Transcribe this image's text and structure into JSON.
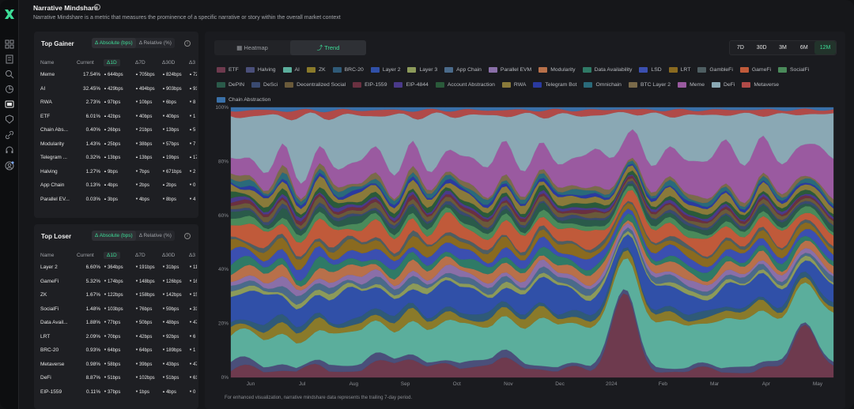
{
  "header": {
    "title": "Narrative Mindshare",
    "subtitle": "Narrative Mindshare is a metric that measures the prominence of a specific narrative or story within the overall market context"
  },
  "gainer": {
    "title": "Top Gainer",
    "toggle": [
      "Δ Absolute (bps)",
      "Δ Relative (%)"
    ],
    "columns": [
      "Name",
      "Current",
      "Δ1D",
      "Δ7D",
      "Δ30D",
      "Δ3"
    ],
    "rows": [
      {
        "name": "Meme",
        "current": "17.54%",
        "d1": "644bps",
        "d7": "705bps",
        "d30": "824bps",
        "d3": "72",
        "d1u": true,
        "d7u": true,
        "d30u": true,
        "d3u": true
      },
      {
        "name": "AI",
        "current": "32.45%",
        "d1": "429bps",
        "d7": "494bps",
        "d30": "903bps",
        "d3": "91",
        "d1u": true,
        "d7u": true,
        "d30u": true,
        "d3u": true
      },
      {
        "name": "RWA",
        "current": "2.73%",
        "d1": "97bps",
        "d7": "10bps",
        "d30": "6bps",
        "d3": "8",
        "d1u": true,
        "d7u": false,
        "d30u": false,
        "d3u": false
      },
      {
        "name": "ETF",
        "current": "6.01%",
        "d1": "42bps",
        "d7": "40bps",
        "d30": "40bps",
        "d3": "1",
        "d1u": true,
        "d7u": false,
        "d30u": false,
        "d3u": false
      },
      {
        "name": "Chain Abs...",
        "current": "0.40%",
        "d1": "26bps",
        "d7": "21bps",
        "d30": "13bps",
        "d3": "5",
        "d1u": true,
        "d7u": false,
        "d30u": false,
        "d3u": true
      },
      {
        "name": "Modularity",
        "current": "1.43%",
        "d1": "25bps",
        "d7": "38bps",
        "d30": "57bps",
        "d3": "7",
        "d1u": true,
        "d7u": false,
        "d30u": false,
        "d3u": false
      },
      {
        "name": "Telegram ...",
        "current": "0.32%",
        "d1": "13bps",
        "d7": "13bps",
        "d30": "19bps",
        "d3": "17",
        "d1u": true,
        "d7u": true,
        "d30u": true,
        "d3u": true
      },
      {
        "name": "Halving",
        "current": "1.27%",
        "d1": "9bps",
        "d7": "7bps",
        "d30": "671bps",
        "d3": "2",
        "d1u": true,
        "d7u": false,
        "d30u": false,
        "d3u": false
      },
      {
        "name": "App Chain",
        "current": "0.13%",
        "d1": "4bps",
        "d7": "2bps",
        "d30": "2bps",
        "d3": "0",
        "d1u": true,
        "d7u": false,
        "d30u": true,
        "d3u": false
      },
      {
        "name": "Parallel EV...",
        "current": "0.03%",
        "d1": "3bps",
        "d7": "4bps",
        "d30": "8bps",
        "d3": "4",
        "d1u": true,
        "d7u": false,
        "d30u": false,
        "d3u": false
      }
    ]
  },
  "loser": {
    "title": "Top Loser",
    "toggle": [
      "Δ Absolute (bps)",
      "Δ Relative (%)"
    ],
    "columns": [
      "Name",
      "Current",
      "Δ1D",
      "Δ7D",
      "Δ30D",
      "Δ3"
    ],
    "rows": [
      {
        "name": "Layer 2",
        "current": "6.60%",
        "d1": "364bps",
        "d7": "191bps",
        "d30": "31bps",
        "d3": "11",
        "d1u": false,
        "d7u": false,
        "d30u": false,
        "d3u": false
      },
      {
        "name": "GameFi",
        "current": "5.32%",
        "d1": "174bps",
        "d7": "148bps",
        "d30": "126bps",
        "d3": "16",
        "d1u": false,
        "d7u": false,
        "d30u": false,
        "d3u": false
      },
      {
        "name": "ZK",
        "current": "1.67%",
        "d1": "122bps",
        "d7": "158bps",
        "d30": "142bps",
        "d3": "15",
        "d1u": false,
        "d7u": false,
        "d30u": false,
        "d3u": false
      },
      {
        "name": "SocialFi",
        "current": "1.48%",
        "d1": "103bps",
        "d7": "76bps",
        "d30": "59bps",
        "d3": "31",
        "d1u": false,
        "d7u": false,
        "d30u": false,
        "d3u": true
      },
      {
        "name": "Data Avail...",
        "current": "1.88%",
        "d1": "77bps",
        "d7": "50bps",
        "d30": "48bps",
        "d3": "47",
        "d1u": false,
        "d7u": false,
        "d30u": false,
        "d3u": false
      },
      {
        "name": "LRT",
        "current": "2.09%",
        "d1": "70bps",
        "d7": "42bps",
        "d30": "92bps",
        "d3": "6",
        "d1u": false,
        "d7u": false,
        "d30u": false,
        "d3u": false
      },
      {
        "name": "BRC-20",
        "current": "0.93%",
        "d1": "64bps",
        "d7": "64bps",
        "d30": "189bps",
        "d3": "1",
        "d1u": false,
        "d7u": false,
        "d30u": false,
        "d3u": false
      },
      {
        "name": "Metaverse",
        "current": "0.98%",
        "d1": "58bps",
        "d7": "39bps",
        "d30": "43bps",
        "d3": "47",
        "d1u": false,
        "d7u": false,
        "d30u": false,
        "d3u": false
      },
      {
        "name": "DeFi",
        "current": "8.87%",
        "d1": "51bps",
        "d7": "102bps",
        "d30": "51bps",
        "d3": "61",
        "d1u": false,
        "d7u": false,
        "d30u": false,
        "d3u": false
      },
      {
        "name": "EIP-1559",
        "current": "0.11%",
        "d1": "37bps",
        "d7": "1bps",
        "d30": "4bps",
        "d3": "0",
        "d1u": false,
        "d7u": false,
        "d30u": true,
        "d3u": false
      }
    ]
  },
  "chart_panel": {
    "tabs": [
      "Heatmap",
      "Trend"
    ],
    "active_tab": "Trend",
    "ranges": [
      "7D",
      "30D",
      "3M",
      "6M",
      "12M"
    ],
    "active_range": "12M",
    "footnote": "For enhanced visualization, narrative mindshare data represents the trailing 7-day period."
  },
  "chart_data": {
    "type": "area",
    "stacked": true,
    "normalized_percent": true,
    "x_ticks": [
      "Jun",
      "Jul",
      "Aug",
      "Sep",
      "Oct",
      "Nov",
      "Dec",
      "2024",
      "Feb",
      "Mar",
      "Apr",
      "May"
    ],
    "y_ticks": [
      "0%",
      "20%",
      "40%",
      "60%",
      "80%",
      "100%"
    ],
    "ylim": [
      0,
      100
    ],
    "legend_placement": "top",
    "series": [
      {
        "name": "ETF",
        "color": "#6e3a4e"
      },
      {
        "name": "Halving",
        "color": "#4a4f7a"
      },
      {
        "name": "AI",
        "color": "#5bae9c"
      },
      {
        "name": "ZK",
        "color": "#8a7a2a"
      },
      {
        "name": "BRC-20",
        "color": "#2f5a78"
      },
      {
        "name": "Layer 2",
        "color": "#3050a8"
      },
      {
        "name": "Layer 3",
        "color": "#8c9a5a"
      },
      {
        "name": "App Chain",
        "color": "#4a6a8a"
      },
      {
        "name": "Parallel EVM",
        "color": "#8a6fa8"
      },
      {
        "name": "Modularity",
        "color": "#b8704a"
      },
      {
        "name": "Data Availability",
        "color": "#2f7a66"
      },
      {
        "name": "LSD",
        "color": "#3b4fb0"
      },
      {
        "name": "LRT",
        "color": "#8a6a20"
      },
      {
        "name": "GambleFi",
        "color": "#4e5e62"
      },
      {
        "name": "GameFi",
        "color": "#c05a3a"
      },
      {
        "name": "SocialFi",
        "color": "#4a8a5a"
      },
      {
        "name": "DePIN",
        "color": "#2a5a4a"
      },
      {
        "name": "DeSci",
        "color": "#3a4a70"
      },
      {
        "name": "Decentralized Social",
        "color": "#6a5a3a"
      },
      {
        "name": "EIP-1559",
        "color": "#6a3040"
      },
      {
        "name": "EIP-4844",
        "color": "#4a3a8a"
      },
      {
        "name": "Account Abstraction",
        "color": "#2a5a3a"
      },
      {
        "name": "RWA",
        "color": "#8a7a3a"
      },
      {
        "name": "Telegram Bot",
        "color": "#2a3aa0"
      },
      {
        "name": "Omnichain",
        "color": "#2a6a7a"
      },
      {
        "name": "BTC Layer 2",
        "color": "#7a6a4a"
      },
      {
        "name": "Meme",
        "color": "#9a5aa0"
      },
      {
        "name": "DeFi",
        "color": "#8aa8b4"
      },
      {
        "name": "Metaverse",
        "color": "#b04a48"
      },
      {
        "name": "Chain Abstraction",
        "color": "#3a70a8"
      }
    ]
  }
}
